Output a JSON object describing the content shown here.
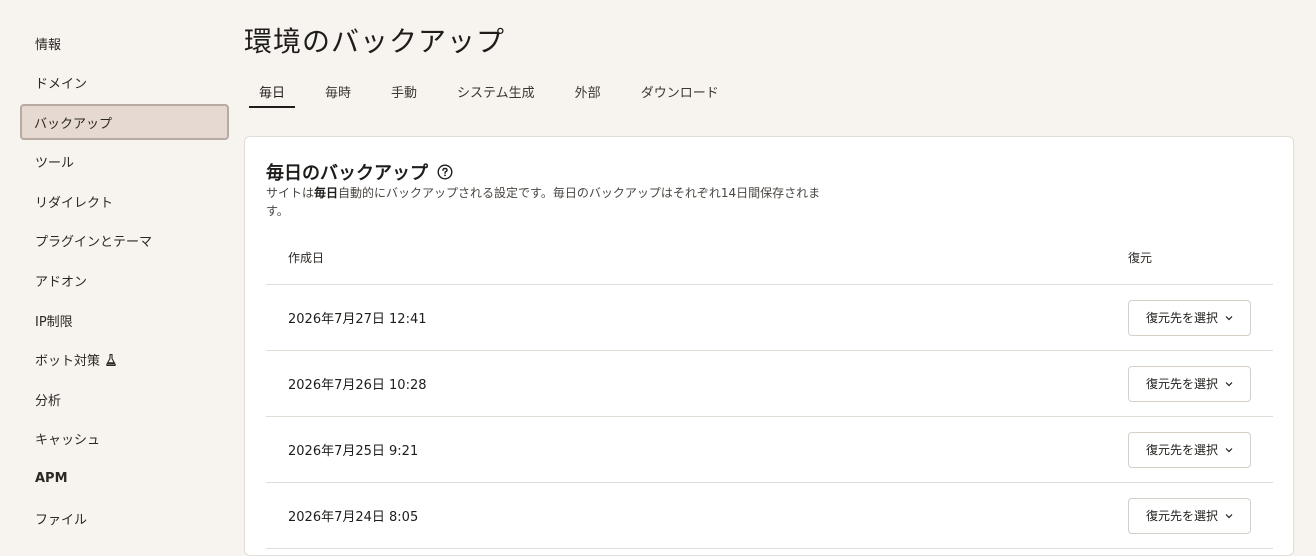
{
  "sidebar": {
    "items": [
      {
        "label": "情報"
      },
      {
        "label": "ドメイン"
      },
      {
        "label": "バックアップ"
      },
      {
        "label": "ツール"
      },
      {
        "label": "リダイレクト"
      },
      {
        "label": "プラグインとテーマ"
      },
      {
        "label": "アドオン"
      },
      {
        "label": "IP制限"
      },
      {
        "label": "ボット対策"
      },
      {
        "label": "分析"
      },
      {
        "label": "キャッシュ"
      },
      {
        "label": "APM"
      },
      {
        "label": "ファイル"
      }
    ],
    "active_index": 2
  },
  "page": {
    "title": "環境のバックアップ"
  },
  "tabs": [
    {
      "label": "毎日"
    },
    {
      "label": "毎時"
    },
    {
      "label": "手動"
    },
    {
      "label": "システム生成"
    },
    {
      "label": "外部"
    },
    {
      "label": "ダウンロード"
    }
  ],
  "card": {
    "title": "毎日のバックアップ",
    "desc_prefix": "サイトは",
    "desc_bold": "毎日",
    "desc_suffix": "自動的にバックアップされる設定です。毎日のバックアップはそれぞれ14日間保存されます。"
  },
  "table": {
    "headers": {
      "date": "作成日",
      "restore": "復元"
    },
    "rows": [
      {
        "date": "2026年7月27日 12:41",
        "action": "復元先を選択"
      },
      {
        "date": "2026年7月26日 10:28",
        "action": "復元先を選択"
      },
      {
        "date": "2026年7月25日 9:21",
        "action": "復元先を選択"
      },
      {
        "date": "2026年7月24日 8:05",
        "action": "復元先を選択"
      }
    ]
  },
  "icons": {
    "help": "question-circle-icon",
    "chevron": "chevron-down-icon",
    "flask": "flask-icon"
  },
  "colors": {
    "background": "#f7f4f0",
    "active_nav_bg": "#e6d9d1",
    "active_nav_border": "#b8aaa1",
    "card_bg": "#ffffff",
    "divider": "#e3ddd7"
  }
}
